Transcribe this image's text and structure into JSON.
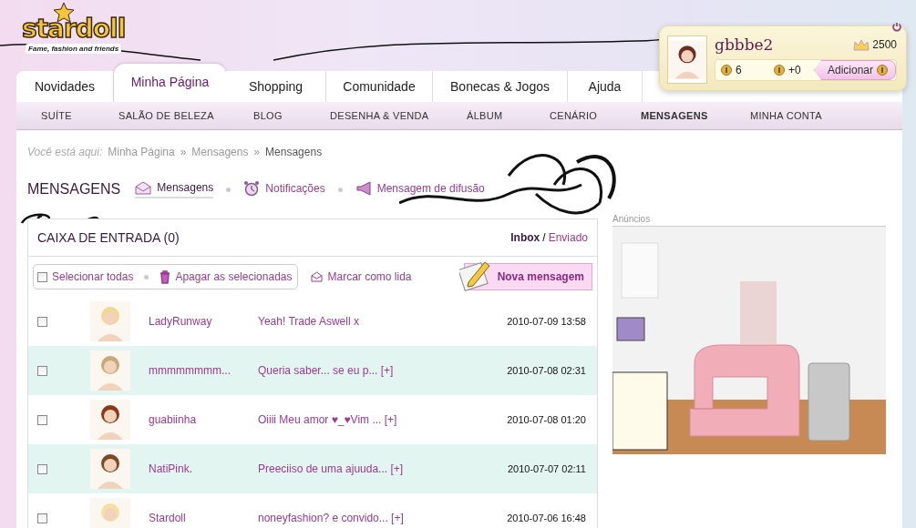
{
  "logo": {
    "name": "stardoll",
    "tagline": "Fame, fashion and friends"
  },
  "user": {
    "name": "gbbbe2",
    "crowns": "2500",
    "coins": "6",
    "starcoins": "+0",
    "add_button": "Adicionar"
  },
  "tabs": [
    {
      "label": "Novidades",
      "selected": false
    },
    {
      "label": "Minha Página",
      "selected": true
    },
    {
      "label": "Shopping",
      "selected": false
    },
    {
      "label": "Comunidade",
      "selected": false
    },
    {
      "label": "Bonecas & Jogos",
      "selected": false
    },
    {
      "label": "Ajuda",
      "selected": false
    }
  ],
  "subnav": [
    {
      "label": "SUÍTE",
      "selected": false
    },
    {
      "label": "SALÃO DE BELEZA",
      "selected": false
    },
    {
      "label": "BLOG",
      "selected": false
    },
    {
      "label": "DESENHA & VENDA",
      "selected": false
    },
    {
      "label": "ÁLBUM",
      "selected": false
    },
    {
      "label": "CENÁRIO",
      "selected": false
    },
    {
      "label": "MENSAGENS",
      "selected": true
    },
    {
      "label": "MINHA CONTA",
      "selected": false
    }
  ],
  "breadcrumb": {
    "prefix": "Você está aqui:",
    "separator": "»",
    "items": [
      "Minha Página",
      "Mensagens",
      "Mensagens"
    ]
  },
  "section": {
    "title": "MENSAGENS",
    "links": [
      {
        "label": "Mensagens",
        "kind": "envelope",
        "selected": true
      },
      {
        "label": "Notificações",
        "kind": "clock",
        "selected": false
      },
      {
        "label": "Mensagem de difusão",
        "kind": "megaphone",
        "selected": false
      }
    ]
  },
  "inbox": {
    "title": "CAIXA DE ENTRADA (0)",
    "separator": "/",
    "views": [
      {
        "label": "Inbox",
        "selected": true
      },
      {
        "label": "Enviado",
        "selected": false
      }
    ],
    "select_all": {
      "label": "Selecionar todas",
      "checked": false
    },
    "delete_label": "Apagar as selecionadas",
    "mark_read_label": "Marcar como lida",
    "new_message_label": "Nova mensagem",
    "messages": [
      {
        "sender": "LadyRunway",
        "subject": "Yeah! Trade Aswell x",
        "date": "2010-07-09 13:58",
        "checked": false
      },
      {
        "sender": "mmmmmmmm...",
        "subject": "Queria saber... se eu p... [+]",
        "date": "2010-07-08 02:31",
        "checked": false
      },
      {
        "sender": "guabiinha",
        "subject": "Oiiii Meu amor ♥_♥Vim ... [+]",
        "date": "2010-07-08 01:20",
        "checked": false
      },
      {
        "sender": "NatiPink.",
        "subject": "Preeciiso de uma ajuuda... [+]",
        "date": "2010-07-07 02:11",
        "checked": false
      },
      {
        "sender": "Stardoll",
        "subject": "noneyfashion? e convido... [+]",
        "date": "2010-07-06 16:48",
        "checked": false
      }
    ]
  },
  "ad": {
    "label": "Anúncios"
  }
}
